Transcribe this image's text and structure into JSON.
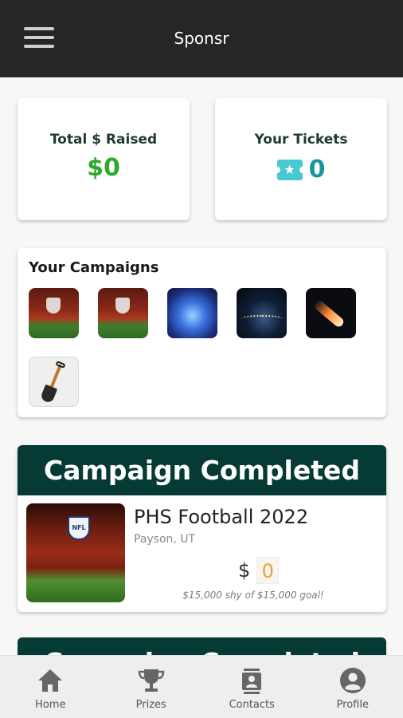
{
  "app": {
    "title": "Sponsr"
  },
  "stats": {
    "raised_label": "Total $ Raised",
    "raised_value": "$0",
    "tickets_label": "Your Tickets",
    "tickets_value": "0"
  },
  "campaigns": {
    "title": "Your Campaigns",
    "thumbnails": [
      "football-image",
      "football-image",
      "blue-light-image",
      "stadium-night-image",
      "meteor-image",
      "shovel-image"
    ]
  },
  "completed_card": {
    "header": "Campaign Completed",
    "name": "PHS Football 2022",
    "location": "Payson, UT",
    "currency": "$",
    "amount": "0",
    "goal_text": "$15,000 shy of $15,000 goal!"
  },
  "next_card": {
    "header": "Campaign Completed"
  },
  "nav": {
    "home": "Home",
    "prizes": "Prizes",
    "contacts": "Contacts",
    "profile": "Profile"
  },
  "colors": {
    "appbar": "#262626",
    "header_green": "#063a35",
    "money_green": "#2daa2d",
    "ticket_teal": "#1896a0",
    "amount_orange": "#e6a23c"
  }
}
